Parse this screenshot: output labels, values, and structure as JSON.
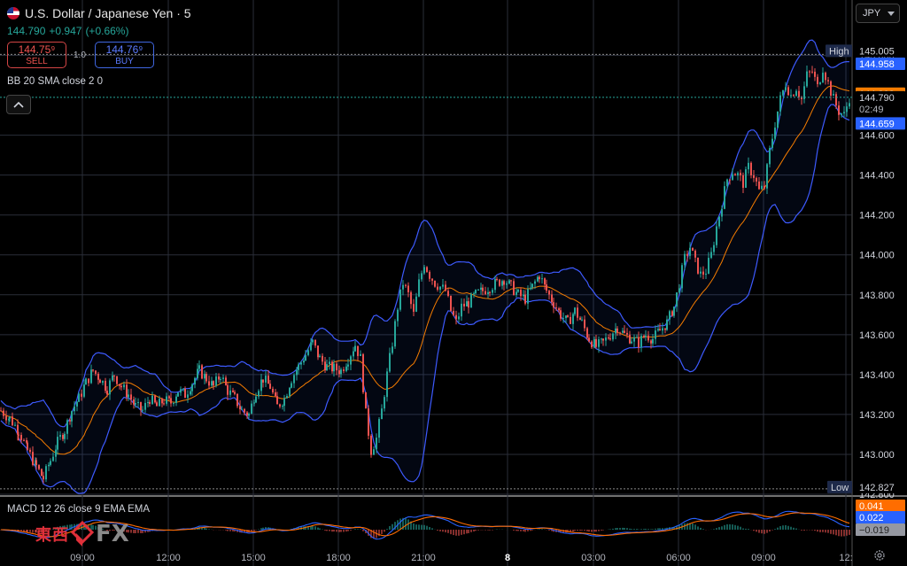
{
  "header": {
    "symbol": "U.S. Dollar / Japanese Yen · 5",
    "last": "144.790",
    "change": "+0.947",
    "change_pct": "(+0.66%)"
  },
  "trade": {
    "sell_price": "144.75⁹",
    "sell_label": "SELL",
    "buy_price": "144.76⁹",
    "buy_label": "BUY",
    "lot": "1.0"
  },
  "indicator_label": "BB 20 SMA close 2 0",
  "currency_selector": "JPY",
  "macd_label": "MACD 12 26 close 9 EMA EMA",
  "watermark": {
    "cn": "東西",
    "fx": "FX"
  },
  "colors": {
    "up": "#26a69a",
    "down": "#ef5350",
    "bb": "#3d5afe",
    "sma": "#f57c00",
    "macd": "#2962ff",
    "signal": "#ff6d00"
  },
  "chart_data": {
    "type": "candlestick",
    "symbol": "USDJPY",
    "timeframe": "5",
    "ylim": [
      142.8,
      145.1
    ],
    "y_ticks": [
      "145.000",
      "144.600",
      "144.400",
      "144.200",
      "144.000",
      "143.800",
      "143.600",
      "143.400",
      "143.200",
      "143.000",
      "142.800"
    ],
    "x_ticks": [
      "09:00",
      "12:00",
      "15:00",
      "18:00",
      "21:00",
      "8",
      "03:00",
      "06:00",
      "09:00",
      "12:"
    ],
    "price_labels": {
      "high_label": "High",
      "high": "145.005",
      "bb_upper": "144.958",
      "bb_basis": "144.808",
      "last": "144.790",
      "countdown": "02:49",
      "bb_lower": "144.659",
      "low_label": "Low",
      "low": "142.827"
    },
    "macd_values": {
      "signal": "0.041",
      "macd": "0.022",
      "histogram": "−0.019"
    },
    "close_path": [
      [
        0,
        143.22
      ],
      [
        10,
        143.18
      ],
      [
        20,
        143.12
      ],
      [
        30,
        143.02
      ],
      [
        40,
        142.94
      ],
      [
        48,
        142.88
      ],
      [
        56,
        142.97
      ],
      [
        64,
        143.06
      ],
      [
        72,
        143.12
      ],
      [
        80,
        143.22
      ],
      [
        88,
        143.28
      ],
      [
        96,
        143.36
      ],
      [
        104,
        143.42
      ],
      [
        112,
        143.38
      ],
      [
        120,
        143.33
      ],
      [
        128,
        143.4
      ],
      [
        136,
        143.34
      ],
      [
        144,
        143.3
      ],
      [
        152,
        143.24
      ],
      [
        160,
        143.22
      ],
      [
        168,
        143.28
      ],
      [
        176,
        143.24
      ],
      [
        184,
        143.27
      ],
      [
        192,
        143.26
      ],
      [
        200,
        143.32
      ],
      [
        208,
        143.3
      ],
      [
        216,
        143.36
      ],
      [
        224,
        143.42
      ],
      [
        232,
        143.38
      ],
      [
        240,
        143.34
      ],
      [
        248,
        143.4
      ],
      [
        256,
        143.32
      ],
      [
        264,
        143.28
      ],
      [
        272,
        143.22
      ],
      [
        280,
        143.2
      ],
      [
        288,
        143.32
      ],
      [
        296,
        143.38
      ],
      [
        304,
        143.34
      ],
      [
        312,
        143.24
      ],
      [
        320,
        143.28
      ],
      [
        328,
        143.38
      ],
      [
        336,
        143.44
      ],
      [
        344,
        143.5
      ],
      [
        352,
        143.56
      ],
      [
        360,
        143.48
      ],
      [
        368,
        143.44
      ],
      [
        376,
        143.43
      ],
      [
        384,
        143.42
      ],
      [
        392,
        143.48
      ],
      [
        400,
        143.55
      ],
      [
        406,
        143.48
      ],
      [
        412,
        143.2
      ],
      [
        418,
        143.02
      ],
      [
        424,
        143.08
      ],
      [
        430,
        143.22
      ],
      [
        436,
        143.4
      ],
      [
        442,
        143.56
      ],
      [
        448,
        143.74
      ],
      [
        454,
        143.86
      ],
      [
        460,
        143.8
      ],
      [
        466,
        143.7
      ],
      [
        472,
        143.86
      ],
      [
        478,
        143.96
      ],
      [
        484,
        143.9
      ],
      [
        490,
        143.86
      ],
      [
        496,
        143.84
      ],
      [
        502,
        143.82
      ],
      [
        508,
        143.72
      ],
      [
        514,
        143.66
      ],
      [
        520,
        143.74
      ],
      [
        528,
        143.76
      ],
      [
        536,
        143.8
      ],
      [
        544,
        143.82
      ],
      [
        552,
        143.84
      ],
      [
        560,
        143.86
      ],
      [
        568,
        143.88
      ],
      [
        576,
        143.84
      ],
      [
        584,
        143.8
      ],
      [
        592,
        143.78
      ],
      [
        600,
        143.84
      ],
      [
        608,
        143.9
      ],
      [
        616,
        143.82
      ],
      [
        624,
        143.76
      ],
      [
        632,
        143.7
      ],
      [
        640,
        143.66
      ],
      [
        648,
        143.72
      ],
      [
        656,
        143.66
      ],
      [
        664,
        143.58
      ],
      [
        672,
        143.54
      ],
      [
        680,
        143.56
      ],
      [
        688,
        143.6
      ],
      [
        696,
        143.64
      ],
      [
        704,
        143.6
      ],
      [
        712,
        143.58
      ],
      [
        720,
        143.56
      ],
      [
        728,
        143.6
      ],
      [
        736,
        143.58
      ],
      [
        744,
        143.62
      ],
      [
        752,
        143.66
      ],
      [
        760,
        143.74
      ],
      [
        766,
        143.86
      ],
      [
        772,
        143.98
      ],
      [
        778,
        144.04
      ],
      [
        784,
        143.96
      ],
      [
        790,
        143.9
      ],
      [
        796,
        143.92
      ],
      [
        802,
        144.0
      ],
      [
        808,
        144.14
      ],
      [
        814,
        144.26
      ],
      [
        820,
        144.38
      ],
      [
        826,
        144.42
      ],
      [
        832,
        144.4
      ],
      [
        838,
        144.36
      ],
      [
        844,
        144.44
      ],
      [
        850,
        144.4
      ],
      [
        856,
        144.32
      ],
      [
        862,
        144.34
      ],
      [
        868,
        144.52
      ],
      [
        874,
        144.66
      ],
      [
        880,
        144.78
      ],
      [
        886,
        144.86
      ],
      [
        892,
        144.8
      ],
      [
        898,
        144.84
      ],
      [
        904,
        144.78
      ],
      [
        910,
        144.9
      ],
      [
        916,
        144.92
      ],
      [
        922,
        144.84
      ],
      [
        928,
        144.94
      ],
      [
        934,
        144.86
      ],
      [
        940,
        144.78
      ],
      [
        946,
        144.72
      ],
      [
        952,
        144.7
      ],
      [
        958,
        144.79
      ]
    ]
  }
}
